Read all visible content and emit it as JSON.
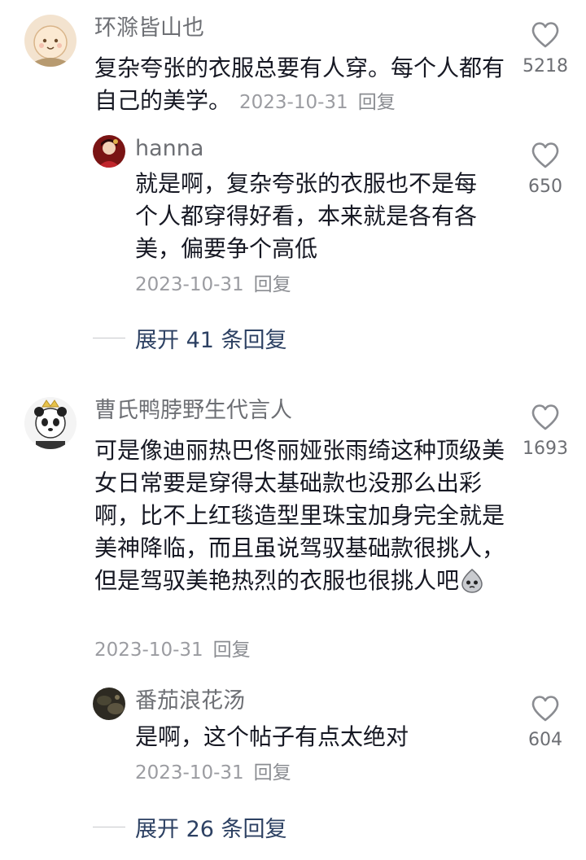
{
  "comments": [
    {
      "username": "环滁皆山也",
      "text": "复杂夸张的衣服总要有人穿。每个人都有自己的美学。",
      "date": "2023-10-31",
      "reply_label": "回复",
      "likes": "5218",
      "avatar_icon": "cartoon-face-avatar",
      "replies": [
        {
          "username": "hanna",
          "text": "就是啊，复杂夸张的衣服也不是每个人都穿得好看，本来就是各有各美，偏要争个高低",
          "date": "2023-10-31",
          "reply_label": "回复",
          "likes": "650",
          "avatar_icon": "red-portrait-avatar"
        }
      ],
      "expand_label": "展开 41 条回复"
    },
    {
      "username": "曹氏鸭脖野生代言人",
      "text": "可是像迪丽热巴佟丽娅张雨绮这种顶级美女日常要是穿得太基础款也没那么出彩啊，比不上红毯造型里珠宝加身完全就是美神降临，而且虽说驾驭基础款很挑人，但是驾驭美艳热烈的衣服也很挑人吧",
      "emoji": "sweat-emoji",
      "date": "2023-10-31",
      "reply_label": "回复",
      "likes": "1693",
      "avatar_icon": "panda-crown-avatar",
      "replies": [
        {
          "username": "番茄浪花汤",
          "text": "是啊，这个帖子有点太绝对",
          "date": "2023-10-31",
          "reply_label": "回复",
          "likes": "604",
          "avatar_icon": "dark-photo-avatar"
        }
      ],
      "expand_label": "展开 26 条回复"
    }
  ]
}
